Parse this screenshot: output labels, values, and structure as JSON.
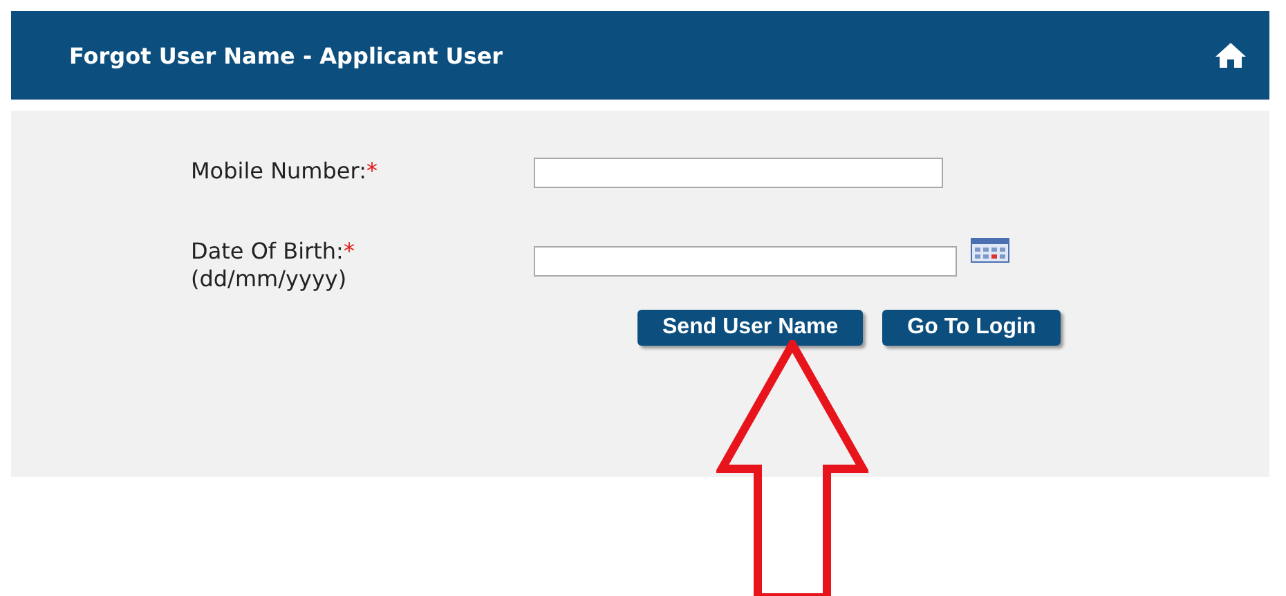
{
  "header": {
    "title": "Forgot User Name - Applicant User"
  },
  "fields": [
    {
      "label": "Mobile Number:",
      "required_mark": "*",
      "kind": "text"
    },
    {
      "label": "Date Of Birth:",
      "required_mark": "*",
      "hint": "(dd/mm/yyyy)",
      "kind": "date"
    }
  ],
  "buttons": [
    "Send User Name",
    "Go To Login"
  ]
}
